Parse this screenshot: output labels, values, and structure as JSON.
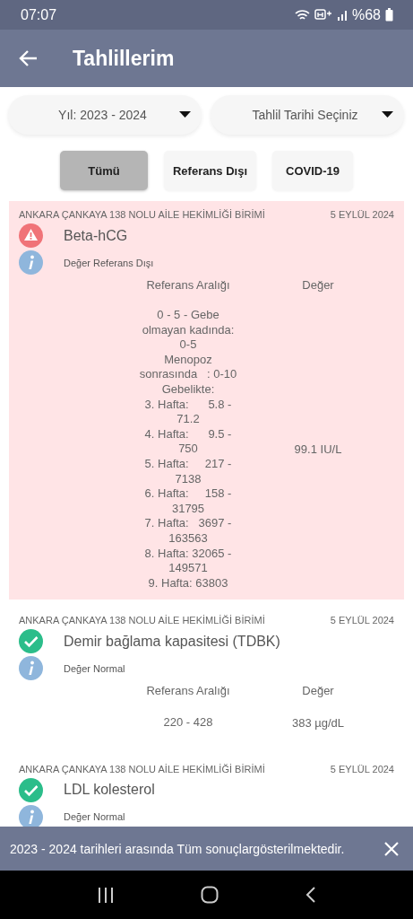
{
  "status_bar": {
    "time": "07:07",
    "battery": "%68"
  },
  "app_bar": {
    "title": "Tahlillerim"
  },
  "filters": [
    {
      "label": "Yıl: 2023 - 2024"
    },
    {
      "label": "Tahlil Tarihi Seçiniz"
    }
  ],
  "tabs": [
    {
      "label": "Tümü",
      "selected": true
    },
    {
      "label": "Referans Dışı",
      "selected": false
    },
    {
      "label": "COVID-19",
      "selected": false
    }
  ],
  "results": [
    {
      "lab": "ANKARA ÇANKAYA 138 NOLU AİLE HEKİMLİĞİ BİRİMİ",
      "date": "5 EYLÜL 2024",
      "test": "Beta-hCG",
      "kind": "out_of_range",
      "status_text": "Değer Referans Dışı",
      "reference_header": "Referans Aralığı",
      "value_header": "Değer",
      "reference": "0 - 5 - Gebe\nolmayan kadında:\n0-5\nMenopoz\nsonrasında   : 0-10\nGebelikte:\n3. Hafta:      5.8 -\n71.2\n4. Hafta:      9.5 -\n750\n5. Hafta:     217 -\n7138\n6. Hafta:     158 -\n31795\n7. Hafta:   3697 -\n163563\n8. Hafta: 32065 -\n149571\n9. Hafta: 63803",
      "value": "99.1 IU/L"
    },
    {
      "lab": "ANKARA ÇANKAYA 138 NOLU AİLE HEKİMLİĞİ BİRİMİ",
      "date": "5 EYLÜL 2024",
      "test": "Demir bağlama kapasitesi (TDBK)",
      "kind": "normal",
      "status_text": "Değer Normal",
      "reference_header": "Referans Aralığı",
      "value_header": "Değer",
      "reference": "220 - 428",
      "value": "383 µg/dL"
    },
    {
      "lab": "ANKARA ÇANKAYA 138 NOLU AİLE HEKİMLİĞİ BİRİMİ",
      "date": "5 EYLÜL 2024",
      "test": "LDL kolesterol",
      "kind": "normal",
      "status_text": "Değer Normal"
    }
  ],
  "snackbar": {
    "message": "2023 - 2024 tarihleri arasında Tüm sonuçlargösterilmektedir."
  }
}
